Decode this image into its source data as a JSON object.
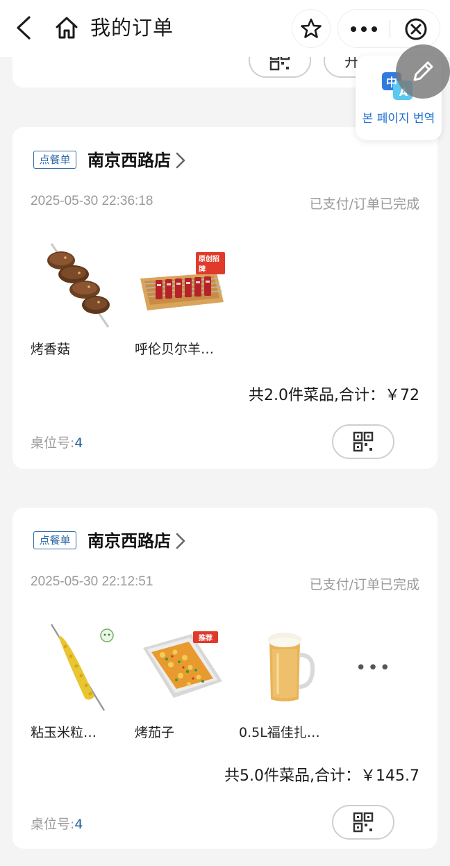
{
  "nav": {
    "title": "我的订单",
    "back_icon": "chevron-left-icon",
    "home_icon": "home-icon",
    "star_icon": "star-icon",
    "more_icon": "more-dots-icon",
    "close_icon": "close-circle-icon"
  },
  "partial_card": {
    "pill2_text": "开…"
  },
  "translate": {
    "label": "본 페이지 번역",
    "icon": "translate-icon",
    "zh": "中",
    "a": "A"
  },
  "orders": [
    {
      "tag": "点餐单",
      "store": "南京西路店",
      "time": "2025-05-30 22:36:18",
      "status": "已支付/订单已完成",
      "items": [
        {
          "name": "烤香菇",
          "image": "grilled-mushroom-skewer"
        },
        {
          "name": "呼伦贝尔羊…",
          "image": "lamb-skewers-tray",
          "badge": "原创招牌"
        }
      ],
      "summary": "共2.0件菜品,合计：￥72",
      "table_label": "桌位号:",
      "table_no": "4"
    },
    {
      "tag": "点餐单",
      "store": "南京西路店",
      "time": "2025-05-30 22:12:51",
      "status": "已支付/订单已完成",
      "items": [
        {
          "name": "粘玉米粒…",
          "image": "corn-skewer"
        },
        {
          "name": "烤茄子",
          "image": "grilled-eggplant-tray",
          "badge": "推荐"
        },
        {
          "name": "0.5L福佳扎…",
          "image": "beer-mug"
        }
      ],
      "more": "•••",
      "summary": "共5.0件菜品,合计：￥145.7",
      "table_label": "桌位号:",
      "table_no": "4"
    }
  ],
  "colors": {
    "accent_blue": "#2f6aa8",
    "link_blue": "#1f6fd1",
    "muted": "#9a9a9a",
    "background": "#f4f4f4"
  }
}
